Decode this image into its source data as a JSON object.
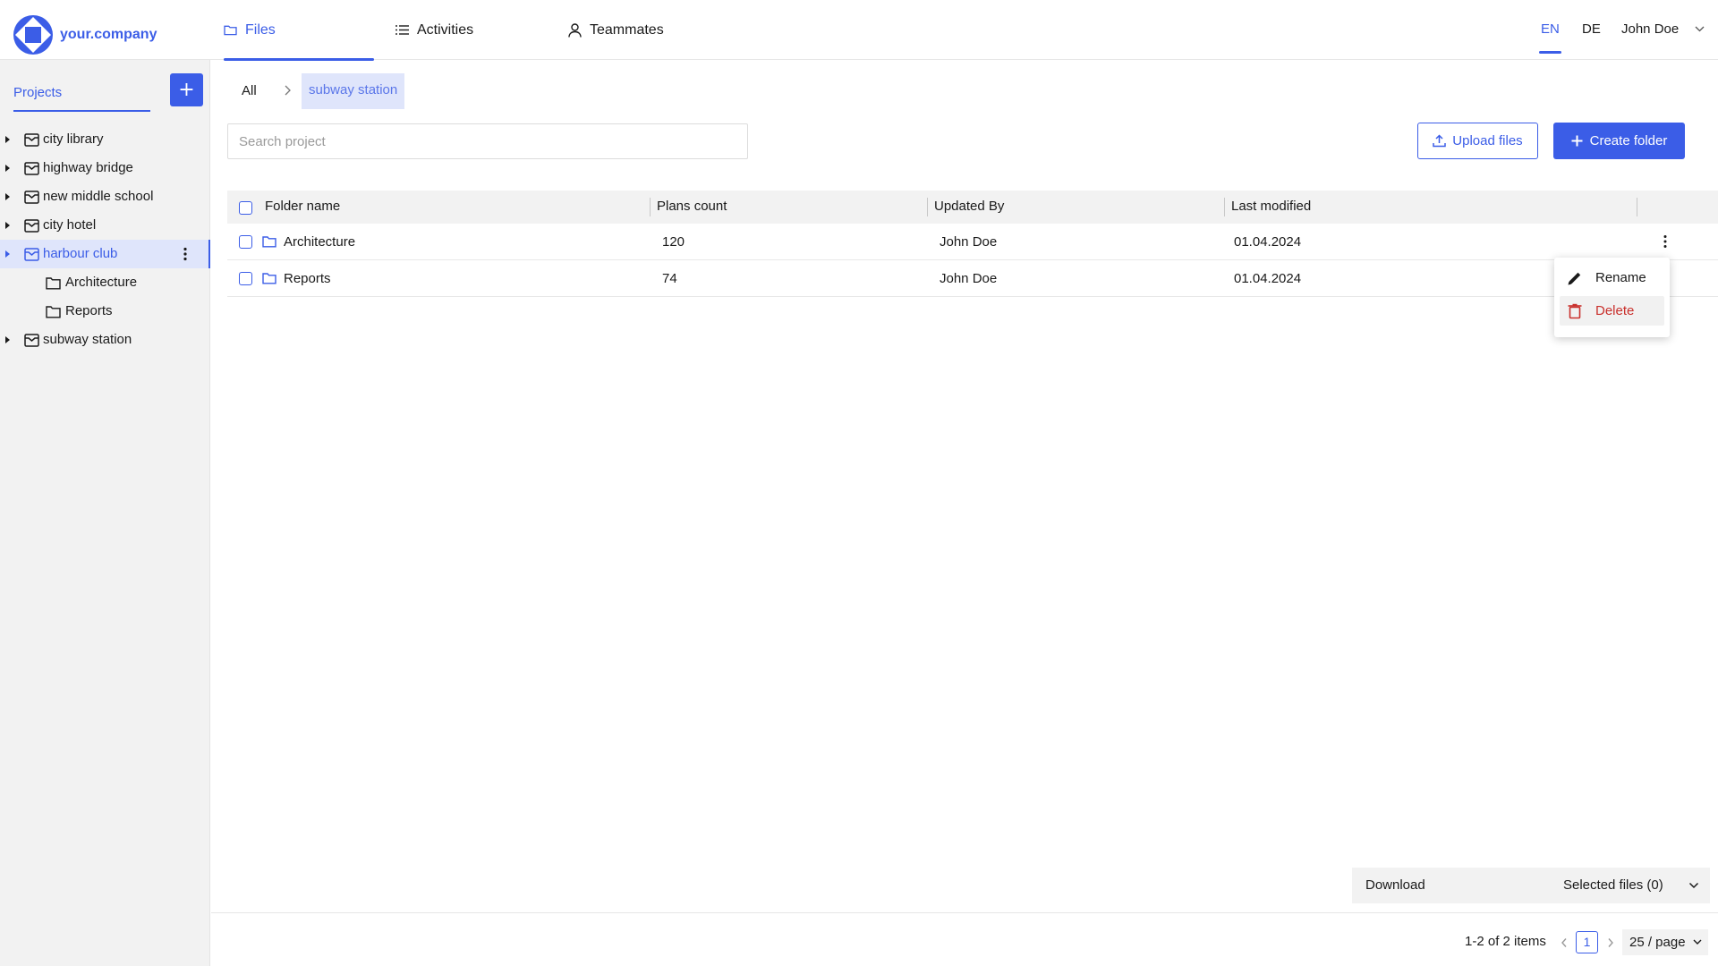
{
  "app": {
    "brand": "your.company",
    "accent_color": "#3b5de7",
    "danger_color": "#c9302c"
  },
  "header": {
    "tabs": [
      {
        "label": "Files",
        "icon": "folder-icon",
        "active": true
      },
      {
        "label": "Activities",
        "icon": "list-icon",
        "active": false
      },
      {
        "label": "Teammates",
        "icon": "user-icon",
        "active": false
      }
    ],
    "languages": [
      {
        "label": "EN",
        "active": true
      },
      {
        "label": "DE",
        "active": false
      }
    ],
    "user_name": "John Doe"
  },
  "sidebar": {
    "projects_label": "Projects",
    "add_label": "+",
    "tree": [
      {
        "label": "city library",
        "expanded": false,
        "selected": false
      },
      {
        "label": "highway bridge",
        "expanded": false,
        "selected": false
      },
      {
        "label": "new middle school",
        "expanded": false,
        "selected": false
      },
      {
        "label": "city hotel",
        "expanded": false,
        "selected": false
      },
      {
        "label": "harbour club",
        "expanded": true,
        "selected": true,
        "children": [
          {
            "label": "Architecture"
          },
          {
            "label": "Reports"
          }
        ]
      },
      {
        "label": "subway station",
        "expanded": false,
        "selected": false
      }
    ]
  },
  "main": {
    "breadcrumb": {
      "root": "All",
      "current": "subway station"
    },
    "search": {
      "placeholder": "Search project",
      "value": ""
    },
    "actions": {
      "upload_label": "Upload files",
      "create_label": "Create folder"
    },
    "table": {
      "columns": [
        "Folder name",
        "Plans count",
        "Updated By",
        "Last modified"
      ],
      "rows": [
        {
          "name": "Architecture",
          "plans": "120",
          "updated_by": "John Doe",
          "modified": "01.04.2024"
        },
        {
          "name": "Reports",
          "plans": "74",
          "updated_by": "John Doe",
          "modified": "01.04.2024"
        }
      ]
    },
    "context_menu": {
      "items": [
        {
          "label": "Rename",
          "icon": "pencil-icon"
        },
        {
          "label": "Delete",
          "icon": "trash-icon"
        }
      ]
    }
  },
  "bottom": {
    "download_label": "Download",
    "selected_files": "Selected files (0)",
    "items_count": "1-2 of 2 items",
    "current_page": "1",
    "page_size": "25 / page"
  }
}
